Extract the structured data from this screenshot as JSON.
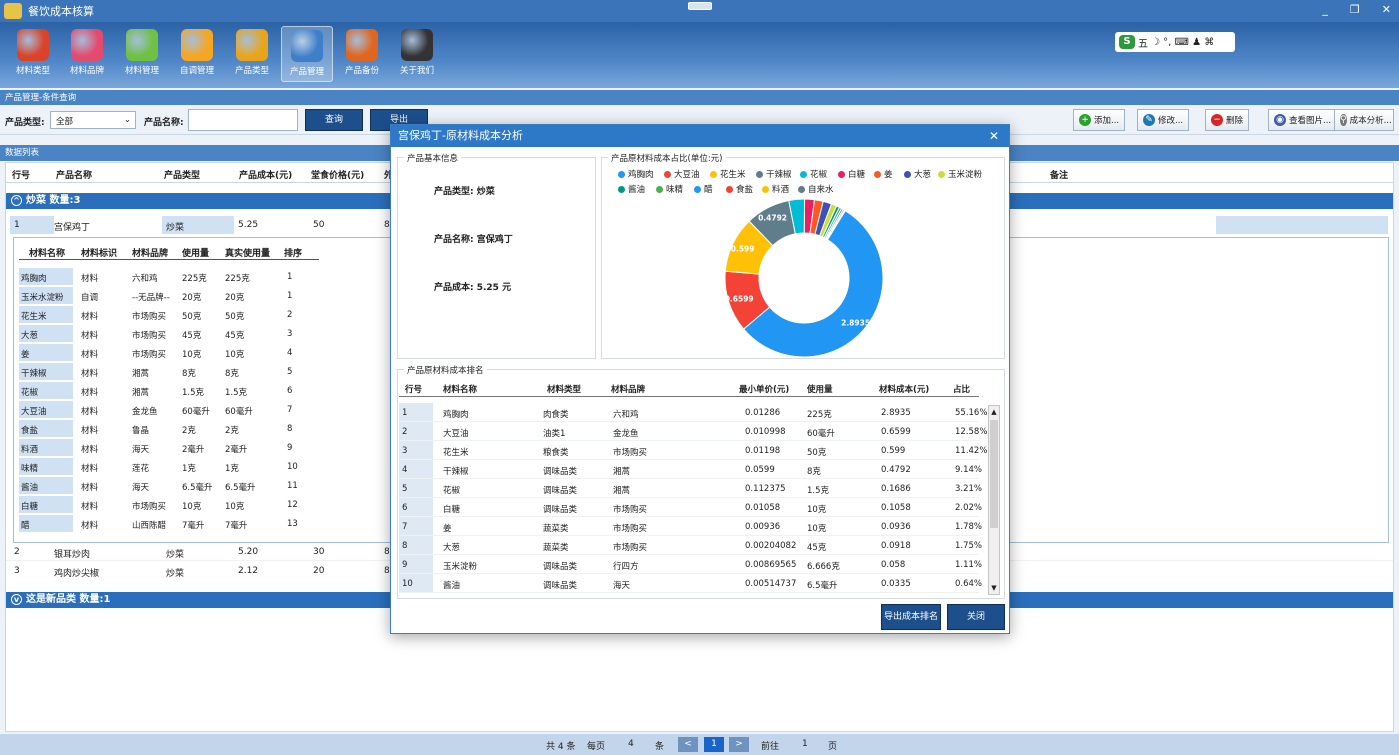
{
  "window": {
    "title": "餐饮成本核算",
    "minimize": "_",
    "restore": "❐",
    "close": "✕"
  },
  "toolbar": {
    "items": [
      {
        "label": "材料类型",
        "icon": "material-type-icon",
        "color": "#d9432a"
      },
      {
        "label": "材料品牌",
        "icon": "material-brand-icon",
        "color": "#e34a6e"
      },
      {
        "label": "材料管理",
        "icon": "material-manage-icon",
        "color": "#6fc043"
      },
      {
        "label": "自调管理",
        "icon": "custom-manage-icon",
        "color": "#f5a623"
      },
      {
        "label": "产品类型",
        "icon": "product-type-icon",
        "color": "#e8a51c"
      },
      {
        "label": "产品管理",
        "icon": "product-manage-icon",
        "color": "#3f7fc9"
      },
      {
        "label": "产品备份",
        "icon": "product-backup-icon",
        "color": "#e0651d"
      },
      {
        "label": "关于我们",
        "icon": "about-icon",
        "color": "#333333"
      }
    ],
    "active_index": 5
  },
  "ime": {
    "logo": "S",
    "mode": "五",
    "symbols": "☽ °, ⌨ ♟ ⌘"
  },
  "query_section": {
    "title": "产品管理-条件查询"
  },
  "filter": {
    "type_label": "产品类型:",
    "type_value": "全部",
    "name_label": "产品名称:",
    "name_value": "",
    "query_btn": "查询",
    "export_btn": "导出"
  },
  "actions": {
    "add": "添加...",
    "edit": "修改...",
    "delete": "删除",
    "view_image": "查看图片...",
    "cost_analysis": "成本分析..."
  },
  "list_section": {
    "title": "数据列表"
  },
  "grid": {
    "headers": [
      "行号",
      "产品名称",
      "产品类型",
      "产品成本(元)",
      "堂食价格(元)",
      "外",
      "备注"
    ],
    "groups": [
      {
        "label": "炒菜 数量:3"
      },
      {
        "label": "这是新品类 数量:1"
      }
    ],
    "rows": [
      {
        "no": "1",
        "name": "宫保鸡丁",
        "type": "炒菜",
        "cost": "5.25",
        "price": "50",
        "out": "89"
      },
      {
        "no": "2",
        "name": "银耳炒肉",
        "type": "炒菜",
        "cost": "5.20",
        "price": "30",
        "out": "82"
      },
      {
        "no": "3",
        "name": "鸡肉炒尖椒",
        "type": "炒菜",
        "cost": "2.12",
        "price": "20",
        "out": "89"
      }
    ],
    "sub_headers": [
      "材料名称",
      "材料标识",
      "材料品牌",
      "使用量",
      "真实使用量",
      "排序"
    ],
    "sub_rows": [
      [
        "鸡胸肉",
        "材料",
        "六和鸡",
        "225克",
        "225克",
        "1"
      ],
      [
        "玉米水淀粉",
        "自调",
        "--无品牌--",
        "20克",
        "20克",
        "1"
      ],
      [
        "花生米",
        "材料",
        "市场购买",
        "50克",
        "50克",
        "2"
      ],
      [
        "大葱",
        "材料",
        "市场购买",
        "45克",
        "45克",
        "3"
      ],
      [
        "姜",
        "材料",
        "市场购买",
        "10克",
        "10克",
        "4"
      ],
      [
        "干辣椒",
        "材料",
        "湘蒿",
        "8克",
        "8克",
        "5"
      ],
      [
        "花椒",
        "材料",
        "湘蒿",
        "1.5克",
        "1.5克",
        "6"
      ],
      [
        "大豆油",
        "材料",
        "金龙鱼",
        "60毫升",
        "60毫升",
        "7"
      ],
      [
        "食盐",
        "材料",
        "鲁晶",
        "2克",
        "2克",
        "8"
      ],
      [
        "料酒",
        "材料",
        "海天",
        "2毫升",
        "2毫升",
        "9"
      ],
      [
        "味精",
        "材料",
        "莲花",
        "1克",
        "1克",
        "10"
      ],
      [
        "酱油",
        "材料",
        "海天",
        "6.5毫升",
        "6.5毫升",
        "11"
      ],
      [
        "白糖",
        "材料",
        "市场购买",
        "10克",
        "10克",
        "12"
      ],
      [
        "醋",
        "材料",
        "山西陈醋",
        "7毫升",
        "7毫升",
        "13"
      ]
    ]
  },
  "pager": {
    "total": "共 4 条",
    "per_page_label": "每页",
    "per_page": "4",
    "unit": "条",
    "prev": "<",
    "current": "1",
    "next": ">",
    "goto_label": "前往",
    "goto_value": "1",
    "page_unit": "页"
  },
  "modal": {
    "title": "宫保鸡丁-原材料成本分析",
    "close": "✕",
    "basic_title": "产品基本信息",
    "type_line": "产品类型: 炒菜",
    "name_line": "产品名称: 宫保鸡丁",
    "cost_line": "产品成本: 5.25 元",
    "chart_title": "产品原材料成本占比(单位:元)",
    "rank_title": "产品原材料成本排名",
    "rank_headers": [
      "行号",
      "材料名称",
      "材料类型",
      "材料品牌",
      "最小单价(元)",
      "使用量",
      "材料成本(元)",
      "占比"
    ],
    "rank_rows": [
      [
        "1",
        "鸡胸肉",
        "肉食类",
        "六和鸡",
        "0.01286",
        "225克",
        "2.8935",
        "55.16%"
      ],
      [
        "2",
        "大豆油",
        "油类1",
        "金龙鱼",
        "0.010998",
        "60毫升",
        "0.6599",
        "12.58%"
      ],
      [
        "3",
        "花生米",
        "粮食类",
        "市场购买",
        "0.01198",
        "50克",
        "0.599",
        "11.42%"
      ],
      [
        "4",
        "干辣椒",
        "调味品类",
        "湘蒿",
        "0.0599",
        "8克",
        "0.4792",
        "9.14%"
      ],
      [
        "5",
        "花椒",
        "调味品类",
        "湘蒿",
        "0.112375",
        "1.5克",
        "0.1686",
        "3.21%"
      ],
      [
        "6",
        "白糖",
        "调味品类",
        "市场购买",
        "0.01058",
        "10克",
        "0.1058",
        "2.02%"
      ],
      [
        "7",
        "姜",
        "蔬菜类",
        "市场购买",
        "0.00936",
        "10克",
        "0.0936",
        "1.78%"
      ],
      [
        "8",
        "大葱",
        "蔬菜类",
        "市场购买",
        "0.00204082",
        "45克",
        "0.0918",
        "1.75%"
      ],
      [
        "9",
        "玉米淀粉",
        "调味品类",
        "行四方",
        "0.00869565",
        "6.666克",
        "0.058",
        "1.11%"
      ],
      [
        "10",
        "酱油",
        "调味品类",
        "海天",
        "0.00514737",
        "6.5毫升",
        "0.0335",
        "0.64%"
      ]
    ],
    "export_btn": "导出成本排名",
    "close_btn": "关闭"
  },
  "chart_data": {
    "type": "pie",
    "title": "产品原材料成本占比(单位:元)",
    "categories": [
      "鸡胸肉",
      "大豆油",
      "花生米",
      "干辣椒",
      "花椒",
      "白糖",
      "姜",
      "大葱",
      "玉米淀粉",
      "酱油",
      "味精",
      "醋",
      "食盐",
      "料酒",
      "自来水"
    ],
    "values": [
      2.8935,
      0.6599,
      0.599,
      0.4792,
      0.1686,
      0.1058,
      0.0936,
      0.0918,
      0.058,
      0.0335,
      0.025,
      0.02,
      0.015,
      0.01,
      0.001
    ],
    "colors": [
      "#2196f3",
      "#f44336",
      "#ffc107",
      "#607d8b",
      "#00bcd4",
      "#e91e63",
      "#ff5722",
      "#3f51b5",
      "#cddc39",
      "#009688",
      "#4caf50",
      "#2196f3",
      "#f44336",
      "#ffc107",
      "#607d8b"
    ],
    "labels_shown": [
      "2.8935",
      "0.6599",
      "0.599",
      "0.4792"
    ],
    "legend": "top"
  }
}
